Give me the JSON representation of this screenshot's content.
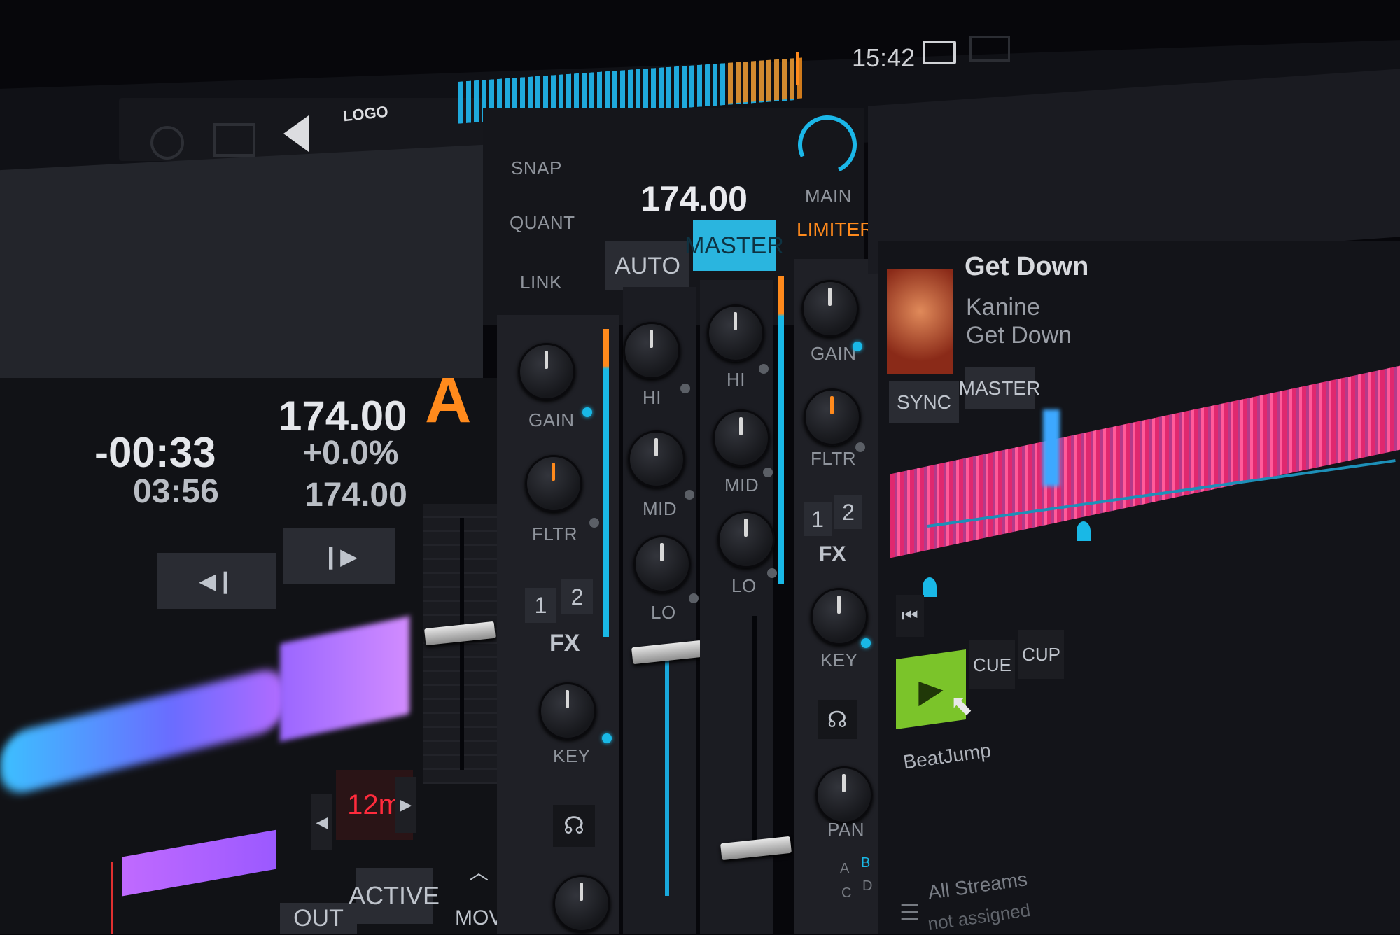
{
  "topbar": {
    "clock": "15:42",
    "icons": [
      "preferences-icon",
      "layout-icon",
      "audio-icon",
      "rec-icon"
    ],
    "rec_label": "LOGO"
  },
  "master": {
    "snap_label": "SNAP",
    "quant_label": "QUANT",
    "link_label": "LINK",
    "tempo": "174.00",
    "auto_label": "AUTO",
    "master_label": "MASTER",
    "main_label": "MAIN",
    "limiter_label": "LIMITER"
  },
  "deck_a": {
    "letter": "A",
    "remaining": "-00:33",
    "total": "03:56",
    "bpm": "174.00",
    "pitch": "+0.0%",
    "base_bpm": "174.00",
    "key_display": "12m",
    "loop_out": "OUT",
    "loop_active": "ACTIVE",
    "move_label": "MOVE"
  },
  "channel_a": {
    "gain": "GAIN",
    "filter": "FLTR",
    "fx1": "1",
    "fx2": "2",
    "fx": "FX",
    "key": "KEY"
  },
  "eq": {
    "hi": "HI",
    "mid": "MID",
    "lo": "LO"
  },
  "channel_b": {
    "gain": "GAIN",
    "filter": "FLTR",
    "fx1": "1",
    "fx2": "2",
    "fx": "FX",
    "key": "KEY",
    "pan": "PAN"
  },
  "deck_b": {
    "title": "Get Down",
    "artist": "Kanine",
    "album": "Get Down",
    "sync_label": "SYNC",
    "master_label": "MASTER",
    "cue_label": "CUE",
    "cup_label": "CUP",
    "beatjump_label": "BeatJump",
    "browser_label": "All Streams",
    "unassigned_label": "not assigned",
    "deck_letters": [
      "A",
      "B",
      "C",
      "D"
    ]
  },
  "colors": {
    "accent_orange": "#ff8a1c",
    "accent_cyan": "#19b8e6",
    "play_green": "#7bc42a",
    "wave_purple": "#b46bff",
    "wave_pink": "#e0286f"
  }
}
